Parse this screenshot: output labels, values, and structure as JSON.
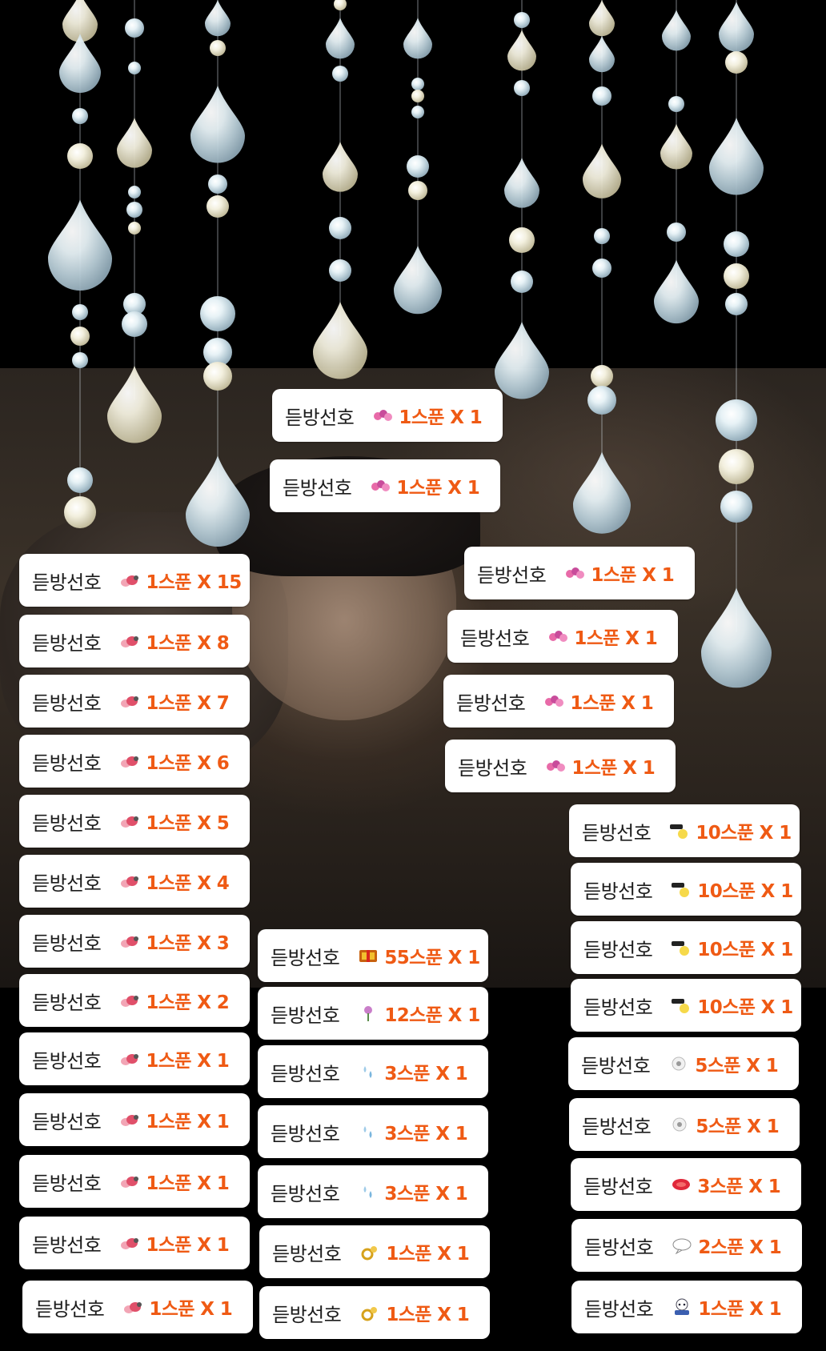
{
  "colors": {
    "nickname": "#1c1c1c",
    "amount": "#ef5a14",
    "badge_bg": "#ffffff"
  },
  "donations": [
    {
      "nickname": "듣방선호",
      "amount": "1스푼 X 1",
      "icon": "pink-flower-sticker"
    },
    {
      "nickname": "듣방선호",
      "amount": "1스푼 X 1",
      "icon": "pink-flower-sticker"
    },
    {
      "nickname": "듣방선호",
      "amount": "1스푼 X 15",
      "icon": "pink-bunny-sticker"
    },
    {
      "nickname": "듣방선호",
      "amount": "1스푼 X 8",
      "icon": "pink-bunny-sticker"
    },
    {
      "nickname": "듣방선호",
      "amount": "1스푼 X 7",
      "icon": "pink-bunny-sticker"
    },
    {
      "nickname": "듣방선호",
      "amount": "1스푼 X 6",
      "icon": "pink-bunny-sticker"
    },
    {
      "nickname": "듣방선호",
      "amount": "1스푼 X 5",
      "icon": "pink-bunny-sticker"
    },
    {
      "nickname": "듣방선호",
      "amount": "1스푼 X 4",
      "icon": "pink-bunny-sticker"
    },
    {
      "nickname": "듣방선호",
      "amount": "1스푼 X 3",
      "icon": "pink-bunny-sticker"
    },
    {
      "nickname": "듣방선호",
      "amount": "1스푼 X 2",
      "icon": "pink-bunny-sticker"
    },
    {
      "nickname": "듣방선호",
      "amount": "1스푼 X 1",
      "icon": "pink-bunny-sticker"
    },
    {
      "nickname": "듣방선호",
      "amount": "1스푼 X 1",
      "icon": "pink-bunny-sticker"
    },
    {
      "nickname": "듣방선호",
      "amount": "1스푼 X 1",
      "icon": "pink-bunny-sticker"
    },
    {
      "nickname": "듣방선호",
      "amount": "1스푼 X 1",
      "icon": "pink-bunny-sticker"
    },
    {
      "nickname": "듣방선호",
      "amount": "1스푼 X 1",
      "icon": "pink-bunny-sticker"
    },
    {
      "nickname": "듣방선호",
      "amount": "1스푼 X 1",
      "icon": "pink-flower-sticker"
    },
    {
      "nickname": "듣방선호",
      "amount": "1스푼 X 1",
      "icon": "pink-flower-sticker"
    },
    {
      "nickname": "듣방선호",
      "amount": "1스푼 X 1",
      "icon": "pink-flower-sticker"
    },
    {
      "nickname": "듣방선호",
      "amount": "1스푼 X 1",
      "icon": "pink-flower-sticker"
    },
    {
      "nickname": "듣방선호",
      "amount": "55스푼 X 1",
      "icon": "gold-box-sticker"
    },
    {
      "nickname": "듣방선호",
      "amount": "12스푼 X 1",
      "icon": "rose-sticker"
    },
    {
      "nickname": "듣방선호",
      "amount": "3스푼 X 1",
      "icon": "water-drop-sticker"
    },
    {
      "nickname": "듣방선호",
      "amount": "3스푼 X 1",
      "icon": "water-drop-sticker"
    },
    {
      "nickname": "듣방선호",
      "amount": "3스푼 X 1",
      "icon": "water-drop-sticker"
    },
    {
      "nickname": "듣방선호",
      "amount": "1스푼 X 1",
      "icon": "gold-ring-sticker"
    },
    {
      "nickname": "듣방선호",
      "amount": "1스푼 X 1",
      "icon": "gold-ring-sticker"
    },
    {
      "nickname": "듣방선호",
      "amount": "10스푼 X 1",
      "icon": "sunglasses-face-sticker"
    },
    {
      "nickname": "듣방선호",
      "amount": "10스푼 X 1",
      "icon": "sunglasses-face-sticker"
    },
    {
      "nickname": "듣방선호",
      "amount": "10스푼 X 1",
      "icon": "sunglasses-face-sticker"
    },
    {
      "nickname": "듣방선호",
      "amount": "10스푼 X 1",
      "icon": "sunglasses-face-sticker"
    },
    {
      "nickname": "듣방선호",
      "amount": "5스푼 X 1",
      "icon": "white-flower-sticker"
    },
    {
      "nickname": "듣방선호",
      "amount": "5스푼 X 1",
      "icon": "white-flower-sticker"
    },
    {
      "nickname": "듣방선호",
      "amount": "3스푼 X 1",
      "icon": "red-splash-sticker"
    },
    {
      "nickname": "듣방선호",
      "amount": "2스푼 X 1",
      "icon": "speech-bubble-sticker"
    },
    {
      "nickname": "듣방선호",
      "amount": "1스푼 X 1",
      "icon": "annyeong-character-sticker"
    }
  ]
}
